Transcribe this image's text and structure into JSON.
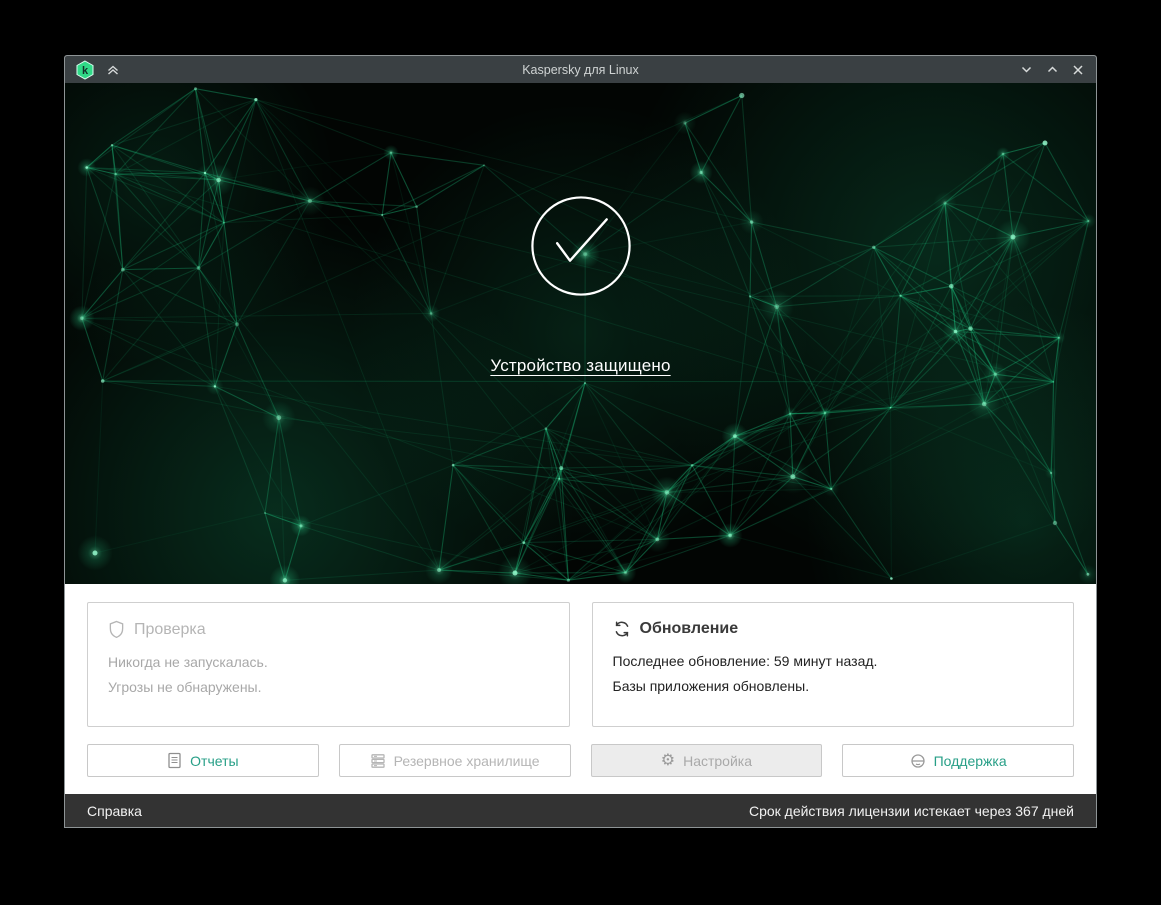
{
  "window": {
    "title": "Kaspersky для Linux"
  },
  "hero": {
    "status_text": "Устройство защищено"
  },
  "cards": [
    {
      "title": "Проверка",
      "icon": "shield-icon",
      "lines": [
        "Никогда не запускалась.",
        "Угрозы не обнаружены."
      ],
      "state": "disabled"
    },
    {
      "title": "Обновление",
      "icon": "sync-icon",
      "lines": [
        "Последнее обновление: 59 минут назад.",
        "Базы приложения обновлены."
      ],
      "state": "enabled"
    }
  ],
  "buttons": [
    {
      "label": "Отчеты",
      "icon": "report-icon",
      "state": "enabled"
    },
    {
      "label": "Резервное хранилище",
      "icon": "storage-icon",
      "state": "disabled"
    },
    {
      "label": "Настройка",
      "icon": "gear-icon",
      "state": "hover"
    },
    {
      "label": "Поддержка",
      "icon": "headset-icon",
      "state": "enabled"
    }
  ],
  "statusbar": {
    "help": "Справка",
    "license": "Срок действия лицензии истекает через 367 дней"
  },
  "colors": {
    "accent": "#279f87",
    "logo_green": "#30d987",
    "titlebar_bg": "#3a4043",
    "statusbar_bg": "#333333",
    "plexus_green": "#1fd68c"
  }
}
